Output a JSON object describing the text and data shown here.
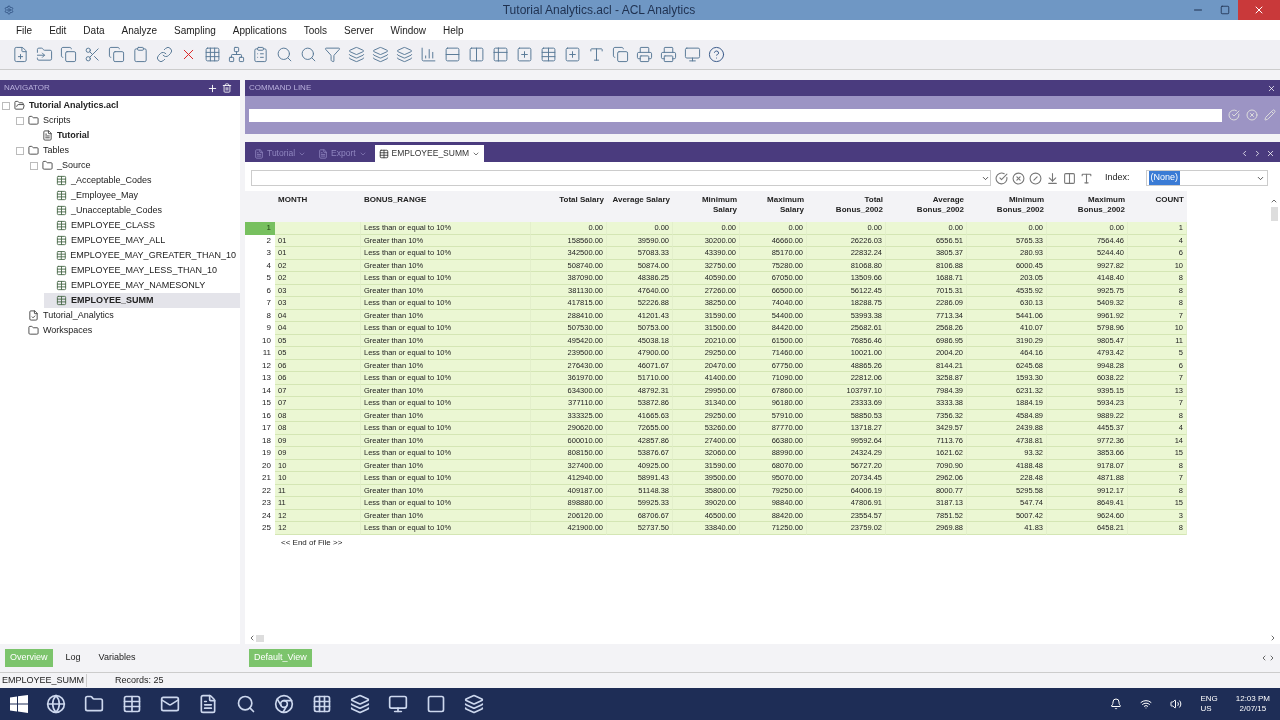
{
  "window": {
    "title": "Tutorial Analytics.acl - ACL Analytics"
  },
  "menu": [
    "File",
    "Edit",
    "Data",
    "Analyze",
    "Sampling",
    "Applications",
    "Tools",
    "Server",
    "Window",
    "Help"
  ],
  "navigator": {
    "title": "NAVIGATOR",
    "tree": [
      {
        "label": "Tutorial Analytics.acl",
        "kind": "project",
        "selected": false,
        "children": [
          {
            "label": "Scripts",
            "kind": "folder",
            "selected": false,
            "children": [
              {
                "label": "Tutorial",
                "kind": "script",
                "selected": false
              }
            ]
          },
          {
            "label": "Tables",
            "kind": "folder",
            "selected": false,
            "children": [
              {
                "label": "_Source",
                "kind": "folder",
                "selected": false,
                "children": [
                  {
                    "label": "_Acceptable_Codes",
                    "kind": "table",
                    "selected": false
                  },
                  {
                    "label": "_Employee_May",
                    "kind": "table",
                    "selected": false
                  },
                  {
                    "label": "_Unacceptable_Codes",
                    "kind": "table",
                    "selected": false
                  },
                  {
                    "label": "EMPLOYEE_CLASS",
                    "kind": "table",
                    "selected": false
                  },
                  {
                    "label": "EMPLOYEE_MAY_ALL",
                    "kind": "table",
                    "selected": false
                  },
                  {
                    "label": "EMPLOYEE_MAY_GREATER_THAN_10",
                    "kind": "table",
                    "selected": false
                  },
                  {
                    "label": "EMPLOYEE_MAY_LESS_THAN_10",
                    "kind": "table",
                    "selected": false
                  },
                  {
                    "label": "EMPLOYEE_MAY_NAMESONLY",
                    "kind": "table",
                    "selected": false
                  },
                  {
                    "label": "EMPLOYEE_SUMM",
                    "kind": "table",
                    "selected": true
                  }
                ]
              }
            ]
          },
          {
            "label": "Tutorial_Analytics",
            "kind": "log",
            "selected": false
          },
          {
            "label": "Workspaces",
            "kind": "folder",
            "selected": false
          }
        ]
      }
    ]
  },
  "command_line": {
    "title": "COMMAND LINE"
  },
  "doc_tabs": [
    {
      "label": "Tutorial",
      "selected": false
    },
    {
      "label": "Export",
      "selected": false
    },
    {
      "label": "EMPLOYEE_SUMM",
      "selected": true
    }
  ],
  "index": {
    "label": "Index:",
    "value": "(None)"
  },
  "table": {
    "columns": [
      {
        "label": "MONTH",
        "kind": "text"
      },
      {
        "label": "BONUS_RANGE",
        "kind": "text"
      },
      {
        "label": "Total Salary",
        "kind": "number"
      },
      {
        "label": "Average Salary",
        "kind": "number"
      },
      {
        "label": "Minimum Salary",
        "kind": "number"
      },
      {
        "label": "Maximum Salary",
        "kind": "number"
      },
      {
        "label": "Total Bonus_2002",
        "kind": "number"
      },
      {
        "label": "Average Bonus_2002",
        "kind": "number"
      },
      {
        "label": "Minimum Bonus_2002",
        "kind": "number"
      },
      {
        "label": "Maximum Bonus_2002",
        "kind": "number"
      },
      {
        "label": "COUNT",
        "kind": "number"
      }
    ],
    "rows": [
      {
        "number": "1",
        "selected": true,
        "cells": [
          "",
          "Less than or equal to 10%",
          "0.00",
          "0.00",
          "0.00",
          "0.00",
          "0.00",
          "0.00",
          "0.00",
          "0.00",
          "1"
        ]
      },
      {
        "number": "2",
        "selected": false,
        "cells": [
          "01",
          "Greater than 10%",
          "158560.00",
          "39590.00",
          "30200.00",
          "46660.00",
          "26226.03",
          "6556.51",
          "5765.33",
          "7564.46",
          "4"
        ]
      },
      {
        "number": "3",
        "selected": false,
        "cells": [
          "01",
          "Less than or equal to 10%",
          "342500.00",
          "57083.33",
          "43390.00",
          "85170.00",
          "22832.24",
          "3805.37",
          "280.93",
          "5244.40",
          "6"
        ]
      },
      {
        "number": "4",
        "selected": false,
        "cells": [
          "02",
          "Greater than 10%",
          "508740.00",
          "50874.00",
          "32750.00",
          "75280.00",
          "81068.80",
          "8106.88",
          "6000.45",
          "9927.82",
          "10"
        ]
      },
      {
        "number": "5",
        "selected": false,
        "cells": [
          "02",
          "Less than or equal to 10%",
          "387090.00",
          "48386.25",
          "40590.00",
          "67050.00",
          "13509.66",
          "1688.71",
          "203.05",
          "4148.40",
          "8"
        ]
      },
      {
        "number": "6",
        "selected": false,
        "cells": [
          "03",
          "Greater than 10%",
          "381130.00",
          "47640.00",
          "27260.00",
          "66500.00",
          "56122.45",
          "7015.31",
          "4535.92",
          "9925.75",
          "8"
        ]
      },
      {
        "number": "7",
        "selected": false,
        "cells": [
          "03",
          "Less than or equal to 10%",
          "417815.00",
          "52226.88",
          "38250.00",
          "74040.00",
          "18288.75",
          "2286.09",
          "630.13",
          "5409.32",
          "8"
        ]
      },
      {
        "number": "8",
        "selected": false,
        "cells": [
          "04",
          "Greater than 10%",
          "288410.00",
          "41201.43",
          "31590.00",
          "54400.00",
          "53993.38",
          "7713.34",
          "5441.06",
          "9961.92",
          "7"
        ]
      },
      {
        "number": "9",
        "selected": false,
        "cells": [
          "04",
          "Less than or equal to 10%",
          "507530.00",
          "50753.00",
          "31500.00",
          "84420.00",
          "25682.61",
          "2568.26",
          "410.07",
          "5798.96",
          "10"
        ]
      },
      {
        "number": "10",
        "selected": false,
        "cells": [
          "05",
          "Greater than 10%",
          "495420.00",
          "45038.18",
          "20210.00",
          "61500.00",
          "76856.46",
          "6986.95",
          "3190.29",
          "9805.47",
          "11"
        ]
      },
      {
        "number": "11",
        "selected": false,
        "cells": [
          "05",
          "Less than or equal to 10%",
          "239500.00",
          "47900.00",
          "29250.00",
          "71460.00",
          "10021.00",
          "2004.20",
          "464.16",
          "4793.42",
          "5"
        ]
      },
      {
        "number": "12",
        "selected": false,
        "cells": [
          "06",
          "Greater than 10%",
          "276430.00",
          "46071.67",
          "20470.00",
          "67750.00",
          "48865.26",
          "8144.21",
          "6245.68",
          "9948.28",
          "6"
        ]
      },
      {
        "number": "13",
        "selected": false,
        "cells": [
          "06",
          "Less than or equal to 10%",
          "361970.00",
          "51710.00",
          "41400.00",
          "71090.00",
          "22812.06",
          "3258.87",
          "1593.30",
          "6038.22",
          "7"
        ]
      },
      {
        "number": "14",
        "selected": false,
        "cells": [
          "07",
          "Greater than 10%",
          "634300.00",
          "48792.31",
          "29950.00",
          "67860.00",
          "103797.10",
          "7984.39",
          "6231.32",
          "9395.15",
          "13"
        ]
      },
      {
        "number": "15",
        "selected": false,
        "cells": [
          "07",
          "Less than or equal to 10%",
          "377110.00",
          "53872.86",
          "31340.00",
          "96180.00",
          "23333.69",
          "3333.38",
          "1884.19",
          "5934.23",
          "7"
        ]
      },
      {
        "number": "16",
        "selected": false,
        "cells": [
          "08",
          "Greater than 10%",
          "333325.00",
          "41665.63",
          "29250.00",
          "57910.00",
          "58850.53",
          "7356.32",
          "4584.89",
          "9889.22",
          "8"
        ]
      },
      {
        "number": "17",
        "selected": false,
        "cells": [
          "08",
          "Less than or equal to 10%",
          "290620.00",
          "72655.00",
          "53260.00",
          "87770.00",
          "13718.27",
          "3429.57",
          "2439.88",
          "4455.37",
          "4"
        ]
      },
      {
        "number": "18",
        "selected": false,
        "cells": [
          "09",
          "Greater than 10%",
          "600010.00",
          "42857.86",
          "27400.00",
          "66380.00",
          "99592.64",
          "7113.76",
          "4738.81",
          "9772.36",
          "14"
        ]
      },
      {
        "number": "19",
        "selected": false,
        "cells": [
          "09",
          "Less than or equal to 10%",
          "808150.00",
          "53876.67",
          "32060.00",
          "88990.00",
          "24324.29",
          "1621.62",
          "93.32",
          "3853.66",
          "15"
        ]
      },
      {
        "number": "20",
        "selected": false,
        "cells": [
          "10",
          "Greater than 10%",
          "327400.00",
          "40925.00",
          "31590.00",
          "68070.00",
          "56727.20",
          "7090.90",
          "4188.48",
          "9178.07",
          "8"
        ]
      },
      {
        "number": "21",
        "selected": false,
        "cells": [
          "10",
          "Less than or equal to 10%",
          "412940.00",
          "58991.43",
          "39500.00",
          "95070.00",
          "20734.45",
          "2962.06",
          "228.48",
          "4871.88",
          "7"
        ]
      },
      {
        "number": "22",
        "selected": false,
        "cells": [
          "11",
          "Greater than 10%",
          "409187.00",
          "51148.38",
          "35800.00",
          "79250.00",
          "64006.19",
          "8000.77",
          "5295.58",
          "9912.17",
          "8"
        ]
      },
      {
        "number": "23",
        "selected": false,
        "cells": [
          "11",
          "Less than or equal to 10%",
          "898880.00",
          "59925.33",
          "39020.00",
          "98840.00",
          "47806.91",
          "3187.13",
          "547.74",
          "8649.41",
          "15"
        ]
      },
      {
        "number": "24",
        "selected": false,
        "cells": [
          "12",
          "Greater than 10%",
          "206120.00",
          "68706.67",
          "46500.00",
          "88420.00",
          "23554.57",
          "7851.52",
          "5007.42",
          "9624.60",
          "3"
        ]
      },
      {
        "number": "25",
        "selected": false,
        "cells": [
          "12",
          "Less than or equal to 10%",
          "421900.00",
          "52737.50",
          "33840.00",
          "71250.00",
          "23759.02",
          "2969.88",
          "41.83",
          "6458.21",
          "8"
        ]
      }
    ],
    "end_marker": "<< End of File >>"
  },
  "bottom_tabs": [
    {
      "label": "Overview",
      "selected": true
    },
    {
      "label": "Log",
      "selected": false
    },
    {
      "label": "Variables",
      "selected": false
    }
  ],
  "view_button": "Default_View",
  "status_bar": {
    "table": "EMPLOYEE_SUMM",
    "records": "Records: 25"
  },
  "taskbar": {
    "language": "ENG",
    "region": "US",
    "time": "12:03 PM",
    "date": "2/07/15"
  }
}
